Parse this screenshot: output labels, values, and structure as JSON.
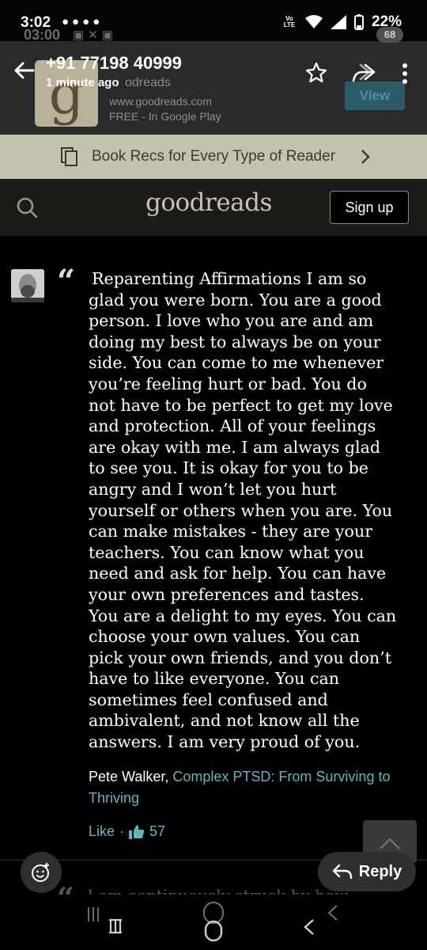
{
  "status_bar": {
    "time": "3:02",
    "ghost_time": "03:00",
    "battery": "22%",
    "volte": "Vo LTE",
    "ghost_badge": "68"
  },
  "chat_header": {
    "contact": "+91 77198 40999",
    "last_seen": "1 minute ago"
  },
  "install_card": {
    "app_letter": "g",
    "app_name_fragment": "odreads",
    "url": "www.goodreads.com",
    "price": "FREE - In Google Play",
    "view_label": "View"
  },
  "banner": {
    "text": "Book Recs for Every Type of Reader"
  },
  "goodreads_header": {
    "logo": "goodreads",
    "signup_label": "Sign up"
  },
  "quote": {
    "lines": [
      "Reparenting Affirmations I am so",
      "glad you were born. You are a good",
      "person. I love who you are and am",
      "doing my best to always be on your",
      "side. You can come to me whenever",
      "you’re feeling hurt or bad. You do",
      "not have to be perfect to get my love",
      "and protection. All of your feelings",
      "are okay with me. I am always glad",
      "to see you. It is okay for you to be",
      "angry and I won’t let you hurt",
      "yourself or others when you are. You",
      "can make mistakes - they are your",
      "teachers. You can know what you",
      "need and ask for help. You can have",
      "your own preferences and tastes.",
      "You are a delight to my eyes. You can",
      "choose your own values. You can",
      "pick your own friends, and you don’t",
      "have to like everyone. You can",
      "sometimes feel confused and",
      "ambivalent, and not know all the",
      "answers. I am very proud of you."
    ],
    "author": "Pete Walker,",
    "book": "Complex PTSD: From Surviving to Thriving",
    "like_label": "Like",
    "separator": "·",
    "like_count": "57"
  },
  "next_quote_peek": "I am continuously struck by how",
  "reply": {
    "label": "Reply"
  },
  "colors": {
    "link": "#64b5c2",
    "banner_bg": "#c4c1ac",
    "header_bg": "#1d1b18"
  }
}
